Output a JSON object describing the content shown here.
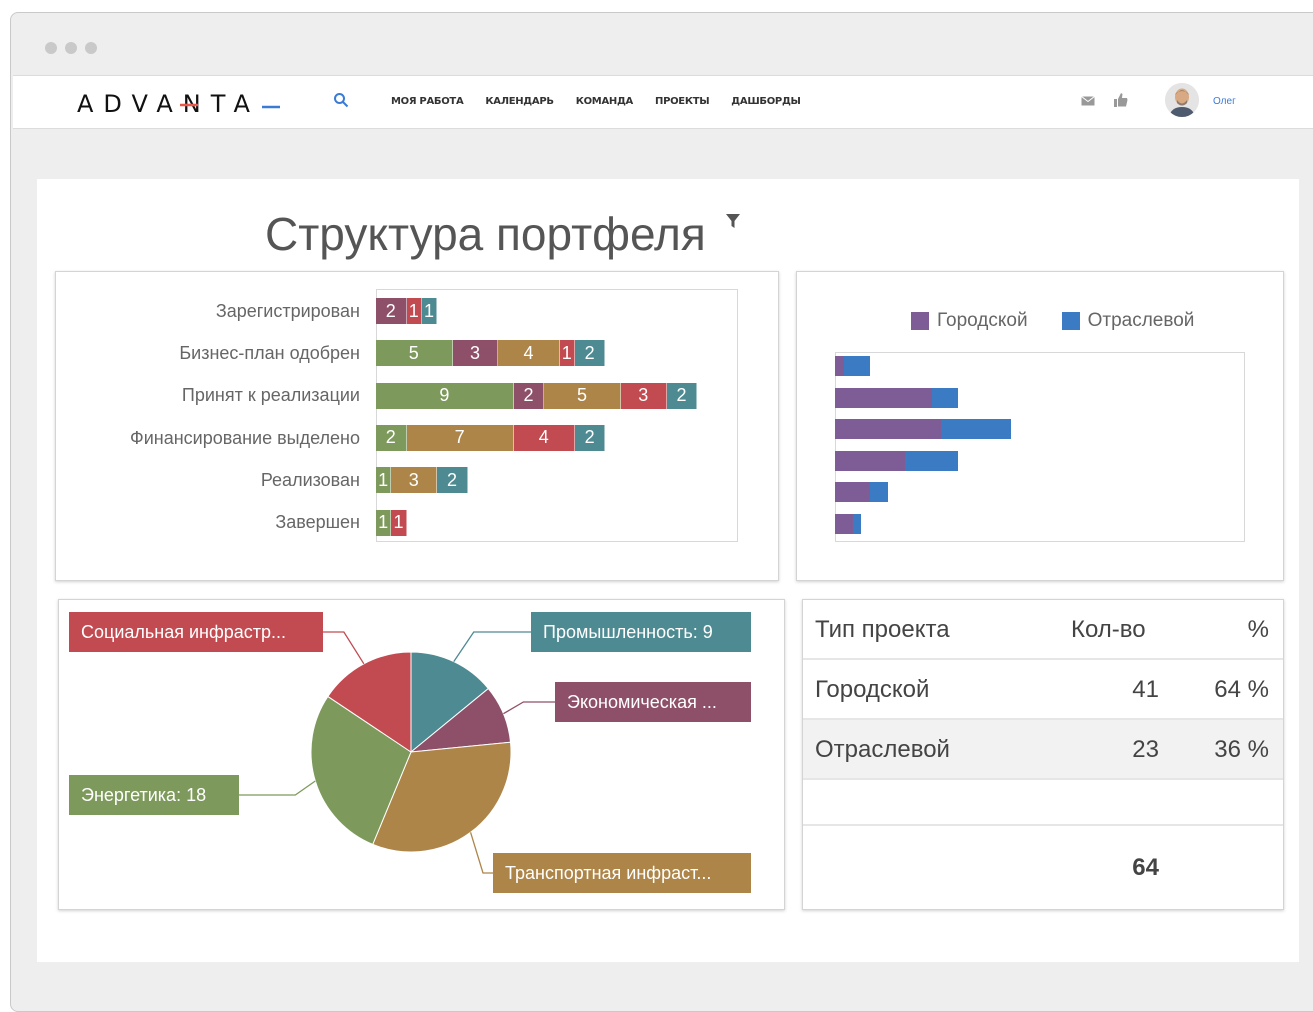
{
  "app": {
    "brand": "ADVANTA",
    "nav": [
      "МОЯ РАБОТА",
      "КАЛЕНДАРЬ",
      "КОМАНДА",
      "ПРОЕКТЫ",
      "ДАШБОРДЫ"
    ],
    "user_name": "Олег"
  },
  "page": {
    "title": "Структура портфеля"
  },
  "colors": {
    "green": "#7d9a5c",
    "plum": "#8e5068",
    "mustard": "#ad8548",
    "red": "#c24a51",
    "teal": "#4e8a92",
    "purple": "#7e5c96",
    "blue": "#3b7bc4"
  },
  "chart_data": [
    {
      "type": "bar",
      "orientation": "horizontal",
      "stacked": true,
      "categories": [
        "Зарегистрирован",
        "Бизнес-план одобрен",
        "Принят к реализации",
        "Финансирование выделено",
        "Реализован",
        "Завершен"
      ],
      "series": [
        {
          "values": [
            0,
            5,
            9,
            2,
            1,
            1
          ]
        },
        {
          "values": [
            2,
            3,
            2,
            0,
            0,
            0
          ]
        },
        {
          "values": [
            0,
            4,
            5,
            7,
            3,
            0
          ]
        },
        {
          "values": [
            1,
            1,
            3,
            4,
            0,
            1
          ]
        },
        {
          "values": [
            1,
            2,
            2,
            2,
            2,
            0
          ]
        }
      ]
    },
    {
      "type": "bar",
      "orientation": "horizontal",
      "stacked": true,
      "legend_position": "top",
      "series": [
        {
          "name": "Городской",
          "values": [
            1,
            11,
            12,
            8,
            4,
            2
          ]
        },
        {
          "name": "Отраслевой",
          "values": [
            3,
            3,
            8,
            6,
            2,
            1
          ]
        }
      ]
    },
    {
      "type": "pie",
      "labels": [
        "Промышленность: 9",
        "Экономическая ...",
        "Транспортная инфраст...",
        "Энергетика: 18",
        "Социальная инфрастр..."
      ],
      "values": [
        9,
        6,
        21,
        18,
        10
      ]
    },
    {
      "type": "table",
      "columns": [
        "Тип проекта",
        "Кол-во",
        "%"
      ],
      "rows": [
        {
          "type": "Городской",
          "count": "41",
          "pct": "64 %"
        },
        {
          "type": "Отраслевой",
          "count": "23",
          "pct": "36 %"
        }
      ],
      "total": "64"
    }
  ]
}
